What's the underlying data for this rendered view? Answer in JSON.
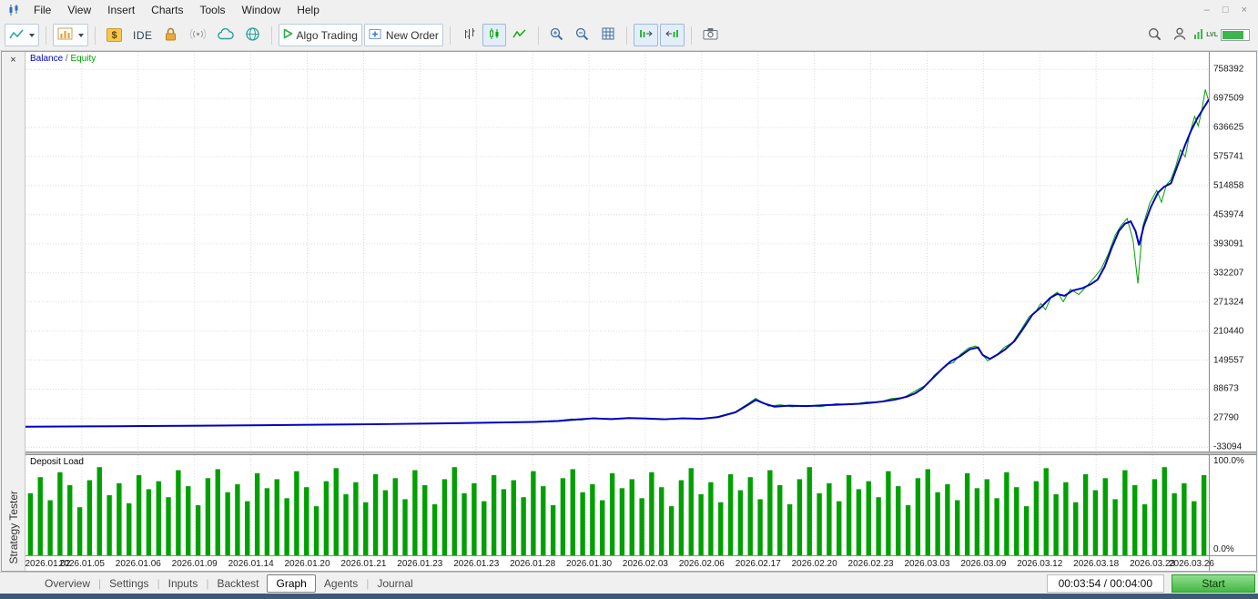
{
  "app": {
    "menu": [
      "File",
      "View",
      "Insert",
      "Charts",
      "Tools",
      "Window",
      "Help"
    ],
    "window_controls": {
      "minimize": "–",
      "restore": "□",
      "close": "×"
    }
  },
  "toolbar": {
    "algo_trading_label": "Algo Trading",
    "new_order_label": "New Order",
    "ide_label": "IDE",
    "level_label": "LVL",
    "icons": [
      "line-studies",
      "chart-template",
      "symbol-dollar",
      "ide",
      "lock",
      "broadcast",
      "cloud",
      "web-community",
      "algo-trading-play",
      "new-order-plus",
      "bar-chart-mode",
      "candlestick-mode",
      "line-chart-mode",
      "zoom-in",
      "zoom-out",
      "grid-toggle",
      "auto-scroll",
      "chart-shift",
      "screenshot",
      "search",
      "profile",
      "level-meter"
    ]
  },
  "legend": {
    "balance": "Balance",
    "separator": " / ",
    "equity": "Equity"
  },
  "tester_panel": {
    "close_glyph": "×",
    "vertical_label": "Strategy Tester",
    "tabs": [
      "Overview",
      "Settings",
      "Inputs",
      "Backtest",
      "Graph",
      "Agents",
      "Journal"
    ],
    "active_tab": "Graph",
    "tab_separator": "|",
    "timer": "00:03:54 / 00:04:00",
    "start_label": "Start"
  },
  "colors": {
    "balance_line": "#0000c0",
    "equity_line": "#00a000",
    "deposit_bars": "#00a000",
    "grid": "#d9d9d9",
    "start_button": "#43b843"
  },
  "chart_data": [
    {
      "type": "line",
      "title": "Balance / Equity",
      "xlabel": "",
      "ylabel": "",
      "grid": true,
      "legend_position": "top-left",
      "ylim": [
        -42000,
        795000
      ],
      "yticks": [
        758392,
        697509,
        636625,
        575741,
        514858,
        453974,
        393091,
        332207,
        271324,
        210440,
        149557,
        88673,
        27790,
        -33094
      ],
      "xticks": [
        "2026.01.02",
        "2026.01.05",
        "2026.01.06",
        "2026.01.09",
        "2026.01.14",
        "2026.01.20",
        "2026.01.21",
        "2026.01.23",
        "2026.01.23",
        "2026.01.28",
        "2026.01.30",
        "2026.02.03",
        "2026.02.06",
        "2026.02.17",
        "2026.02.20",
        "2026.02.23",
        "2026.03.03",
        "2026.03.09",
        "2026.03.12",
        "2026.03.18",
        "2026.03.23",
        "2026.03.26"
      ],
      "series": [
        {
          "name": "Equity",
          "color": "#00a000",
          "width": 1,
          "points": [
            [
              0,
              10000
            ],
            [
              0.05,
              10800
            ],
            [
              0.1,
              11100
            ],
            [
              0.15,
              12400
            ],
            [
              0.2,
              12800
            ],
            [
              0.25,
              14400
            ],
            [
              0.3,
              15100
            ],
            [
              0.35,
              17200
            ],
            [
              0.4,
              18400
            ],
            [
              0.43,
              20600
            ],
            [
              0.45,
              22800
            ],
            [
              0.462,
              26200
            ],
            [
              0.47,
              24000
            ],
            [
              0.48,
              28500
            ],
            [
              0.495,
              25200
            ],
            [
              0.51,
              28800
            ],
            [
              0.525,
              26400
            ],
            [
              0.54,
              24800
            ],
            [
              0.555,
              28300
            ],
            [
              0.571,
              25800
            ],
            [
              0.585,
              31000
            ],
            [
              0.6,
              41500
            ],
            [
              0.61,
              57000
            ],
            [
              0.617,
              69500
            ],
            [
              0.622,
              62000
            ],
            [
              0.628,
              53000
            ],
            [
              0.638,
              56000
            ],
            [
              0.648,
              51500
            ],
            [
              0.66,
              54500
            ],
            [
              0.672,
              52000
            ],
            [
              0.685,
              58000
            ],
            [
              0.698,
              56000
            ],
            [
              0.71,
              61500
            ],
            [
              0.722,
              62000
            ],
            [
              0.732,
              69000
            ],
            [
              0.742,
              71000
            ],
            [
              0.75,
              82000
            ],
            [
              0.757,
              92000
            ],
            [
              0.762,
              98000
            ],
            [
              0.768,
              118000
            ],
            [
              0.773,
              128000
            ],
            [
              0.778,
              140000
            ],
            [
              0.784,
              144000
            ],
            [
              0.79,
              161000
            ],
            [
              0.797,
              175000
            ],
            [
              0.803,
              179000
            ],
            [
              0.808,
              163000
            ],
            [
              0.813,
              148000
            ],
            [
              0.82,
              158000
            ],
            [
              0.827,
              176000
            ],
            [
              0.834,
              186000
            ],
            [
              0.841,
              212000
            ],
            [
              0.848,
              240000
            ],
            [
              0.854,
              252000
            ],
            [
              0.858,
              268000
            ],
            [
              0.862,
              255000
            ],
            [
              0.867,
              283000
            ],
            [
              0.872,
              292000
            ],
            [
              0.877,
              272000
            ],
            [
              0.883,
              298000
            ],
            [
              0.89,
              287000
            ],
            [
              0.897,
              305000
            ],
            [
              0.903,
              322000
            ],
            [
              0.909,
              340000
            ],
            [
              0.915,
              372000
            ],
            [
              0.921,
              412000
            ],
            [
              0.926,
              432000
            ],
            [
              0.931,
              446000
            ],
            [
              0.936,
              400000
            ],
            [
              0.94,
              310000
            ],
            [
              0.944,
              428000
            ],
            [
              0.95,
              478000
            ],
            [
              0.956,
              505000
            ],
            [
              0.96,
              480000
            ],
            [
              0.964,
              516000
            ],
            [
              0.968,
              528000
            ],
            [
              0.972,
              555000
            ],
            [
              0.976,
              590000
            ],
            [
              0.98,
              575000
            ],
            [
              0.984,
              625000
            ],
            [
              0.988,
              660000
            ],
            [
              0.991,
              640000
            ],
            [
              0.994,
              672000
            ],
            [
              0.997,
              716000
            ],
            [
              1,
              692000
            ]
          ]
        },
        {
          "name": "Balance",
          "color": "#0000c0",
          "width": 2,
          "points": [
            [
              0,
              10000
            ],
            [
              0.05,
              10600
            ],
            [
              0.1,
              11300
            ],
            [
              0.15,
              12100
            ],
            [
              0.2,
              13000
            ],
            [
              0.25,
              14100
            ],
            [
              0.3,
              15400
            ],
            [
              0.35,
              16900
            ],
            [
              0.4,
              18700
            ],
            [
              0.43,
              20000
            ],
            [
              0.45,
              22000
            ],
            [
              0.465,
              25000
            ],
            [
              0.48,
              27500
            ],
            [
              0.495,
              26000
            ],
            [
              0.51,
              28000
            ],
            [
              0.525,
              27000
            ],
            [
              0.54,
              25500
            ],
            [
              0.555,
              27500
            ],
            [
              0.571,
              26500
            ],
            [
              0.585,
              30000
            ],
            [
              0.6,
              40000
            ],
            [
              0.61,
              55000
            ],
            [
              0.617,
              66000
            ],
            [
              0.625,
              58000
            ],
            [
              0.633,
              52000
            ],
            [
              0.645,
              54000
            ],
            [
              0.66,
              53000
            ],
            [
              0.675,
              55000
            ],
            [
              0.69,
              56500
            ],
            [
              0.705,
              58000
            ],
            [
              0.714,
              60000
            ],
            [
              0.725,
              63000
            ],
            [
              0.735,
              67000
            ],
            [
              0.745,
              73000
            ],
            [
              0.752,
              80000
            ],
            [
              0.758,
              90000
            ],
            [
              0.762,
              100000
            ],
            [
              0.768,
              115000
            ],
            [
              0.775,
              132000
            ],
            [
              0.782,
              147000
            ],
            [
              0.79,
              158000
            ],
            [
              0.798,
              172000
            ],
            [
              0.805,
              176000
            ],
            [
              0.809,
              160000
            ],
            [
              0.815,
              152000
            ],
            [
              0.822,
              162000
            ],
            [
              0.828,
              172000
            ],
            [
              0.836,
              190000
            ],
            [
              0.843,
              215000
            ],
            [
              0.851,
              245000
            ],
            [
              0.859,
              262000
            ],
            [
              0.866,
              280000
            ],
            [
              0.872,
              288000
            ],
            [
              0.878,
              284000
            ],
            [
              0.885,
              295000
            ],
            [
              0.893,
              300000
            ],
            [
              0.9,
              308000
            ],
            [
              0.906,
              318000
            ],
            [
              0.912,
              345000
            ],
            [
              0.918,
              385000
            ],
            [
              0.924,
              420000
            ],
            [
              0.929,
              435000
            ],
            [
              0.934,
              440000
            ],
            [
              0.938,
              420000
            ],
            [
              0.941,
              390000
            ],
            [
              0.945,
              430000
            ],
            [
              0.951,
              470000
            ],
            [
              0.957,
              500000
            ],
            [
              0.962,
              512000
            ],
            [
              0.968,
              520000
            ],
            [
              0.974,
              560000
            ],
            [
              0.98,
              600000
            ],
            [
              0.985,
              630000
            ],
            [
              0.99,
              655000
            ],
            [
              0.995,
              675000
            ],
            [
              1,
              695000
            ]
          ]
        }
      ]
    },
    {
      "type": "bar",
      "title": "Deposit Load",
      "ylim": [
        0,
        100
      ],
      "ytick_labels": [
        "100.0%",
        "0.0%"
      ],
      "color": "#00a000",
      "values_percent": [
        62,
        78,
        55,
        83,
        70,
        48,
        75,
        88,
        60,
        72,
        52,
        80,
        66,
        74,
        58,
        85,
        69,
        50,
        77,
        86,
        63,
        71,
        54,
        82,
        67,
        76,
        57,
        84,
        68,
        49,
        74,
        87,
        61,
        73,
        53,
        81,
        65,
        77,
        56,
        85,
        70,
        51,
        76,
        88,
        62,
        72,
        54,
        80,
        66,
        75,
        58,
        84,
        69,
        50,
        77,
        86,
        63,
        71,
        55,
        82,
        67,
        76,
        57,
        83,
        68,
        49,
        75,
        87,
        61,
        73,
        53,
        81,
        65,
        78,
        56,
        85,
        70,
        51,
        76,
        88,
        62,
        72,
        54,
        80,
        66,
        74,
        58,
        84,
        69,
        50,
        77,
        86,
        63,
        71,
        55,
        82,
        67,
        76,
        57,
        83,
        68,
        49,
        74,
        87,
        61,
        73,
        53,
        81,
        65,
        77,
        56,
        85,
        70,
        51,
        76,
        88,
        62,
        72,
        54,
        80
      ]
    }
  ]
}
